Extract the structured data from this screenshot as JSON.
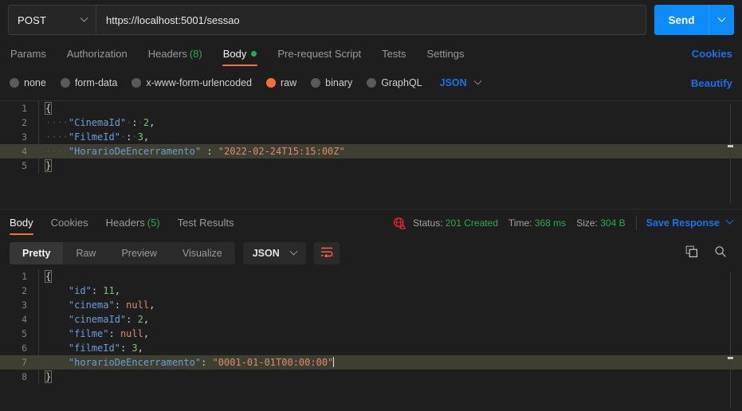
{
  "request": {
    "method": "POST",
    "url": "https://localhost:5001/sessao",
    "send_label": "Send",
    "tabs": [
      {
        "label": "Params",
        "active": false
      },
      {
        "label": "Authorization",
        "active": false
      },
      {
        "label": "Headers",
        "count": "(8)",
        "active": false
      },
      {
        "label": "Body",
        "active": true,
        "dot": true
      },
      {
        "label": "Pre-request Script",
        "active": false
      },
      {
        "label": "Tests",
        "active": false
      },
      {
        "label": "Settings",
        "active": false
      }
    ],
    "cookies_link": "Cookies",
    "beautify_link": "Beautify",
    "body_types": [
      {
        "label": "none",
        "selected": false
      },
      {
        "label": "form-data",
        "selected": false
      },
      {
        "label": "x-www-form-urlencoded",
        "selected": false
      },
      {
        "label": "raw",
        "selected": true
      },
      {
        "label": "binary",
        "selected": false
      },
      {
        "label": "GraphQL",
        "selected": false
      }
    ],
    "raw_format": "JSON",
    "body_lines": [
      {
        "no": "1",
        "content": "{"
      },
      {
        "no": "2",
        "content": "    \"CinemaId\" : 2,"
      },
      {
        "no": "3",
        "content": "    \"FilmeId\" : 3,"
      },
      {
        "no": "4",
        "content": "    \"HorarioDeEncerramento\" : \"2022-02-24T15:15:00Z\"",
        "highlighted": true
      },
      {
        "no": "5",
        "content": "}"
      }
    ]
  },
  "response": {
    "tabs": [
      {
        "label": "Body",
        "active": true
      },
      {
        "label": "Cookies",
        "active": false
      },
      {
        "label": "Headers",
        "count": "(5)",
        "active": false
      },
      {
        "label": "Test Results",
        "active": false
      }
    ],
    "status_label": "Status:",
    "status_value": "201 Created",
    "time_label": "Time:",
    "time_value": "368 ms",
    "size_label": "Size:",
    "size_value": "304 B",
    "save_response": "Save Response",
    "view_modes": [
      {
        "label": "Pretty",
        "active": true
      },
      {
        "label": "Raw",
        "active": false
      },
      {
        "label": "Preview",
        "active": false
      },
      {
        "label": "Visualize",
        "active": false
      }
    ],
    "format": "JSON",
    "body_lines": [
      {
        "no": "1",
        "content": "{"
      },
      {
        "no": "2",
        "content": "    \"id\": 11,"
      },
      {
        "no": "3",
        "content": "    \"cinema\": null,"
      },
      {
        "no": "4",
        "content": "    \"cinemaId\": 2,"
      },
      {
        "no": "5",
        "content": "    \"filme\": null,"
      },
      {
        "no": "6",
        "content": "    \"filmeId\": 3,"
      },
      {
        "no": "7",
        "content": "    \"horarioDeEncerramento\": \"0001-01-01T00:00:00\"",
        "highlighted": true,
        "caret": true
      },
      {
        "no": "8",
        "content": "}"
      }
    ]
  },
  "icons": {
    "method_caret": "chevron-down-icon",
    "send_caret": "chevron-down-icon",
    "ssl_warning": "globe-warning-icon",
    "wrap_lines": "wrap-lines-icon",
    "copy": "copy-icon",
    "search": "search-icon"
  },
  "colors": {
    "accent": "#ff6c37",
    "link": "#1a73e8",
    "send": "#0d8bf9",
    "success": "#2fa84f",
    "warning": "#e5272e",
    "bg": "#1e1e1e",
    "key": "#6a9fd8",
    "string": "#d98f6e",
    "number": "#7fbf7f"
  }
}
